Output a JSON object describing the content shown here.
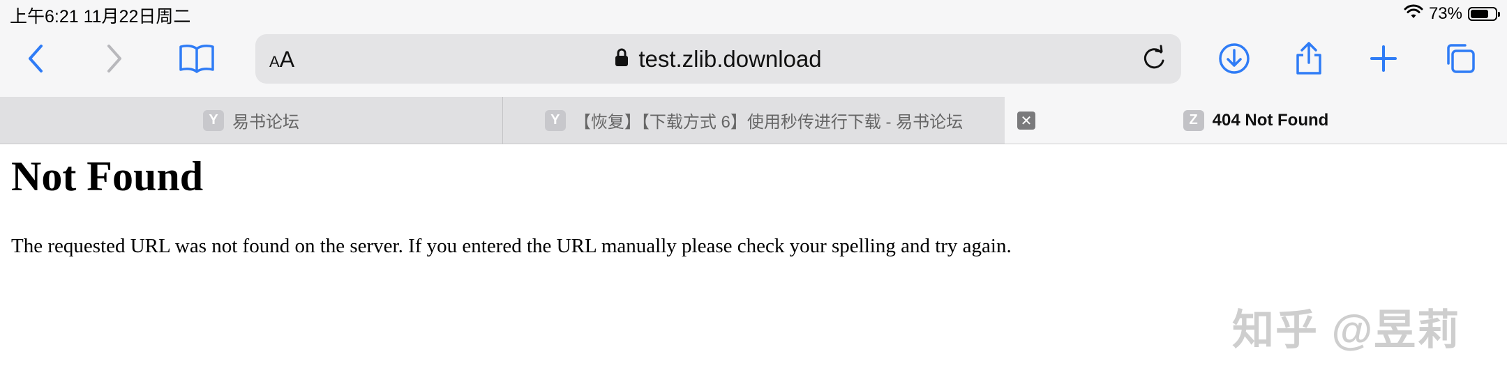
{
  "status_bar": {
    "time": "上午6:21   11月22日周二",
    "battery_percent": "73%",
    "battery_level": 0.73
  },
  "toolbar": {
    "text_size_small": "A",
    "text_size_large": "A",
    "url": "test.zlib.download",
    "icons": [
      "back-icon",
      "forward-icon",
      "bookmarks-icon",
      "lock-icon",
      "reload-icon",
      "download-icon",
      "share-icon",
      "new-tab-icon",
      "tabs-overview-icon"
    ]
  },
  "tabs": [
    {
      "favicon": "Y",
      "title": "易书论坛",
      "active": false
    },
    {
      "favicon": "Y",
      "title": "【恢复】【下载方式 6】使用秒传进行下载 - 易书论坛",
      "active": false
    },
    {
      "favicon": "Z",
      "title": "404 Not Found",
      "active": true
    }
  ],
  "page": {
    "heading": "Not Found",
    "message": "The requested URL was not found on the server. If you entered the URL manually please check your spelling and try again."
  },
  "watermark": "知乎 @昱莉",
  "colors": {
    "accent": "#2f7cf6",
    "chrome_bg": "#f6f6f7",
    "address_bg": "#e4e4e6",
    "inactive_tab_bg": "#e0e0e2"
  }
}
